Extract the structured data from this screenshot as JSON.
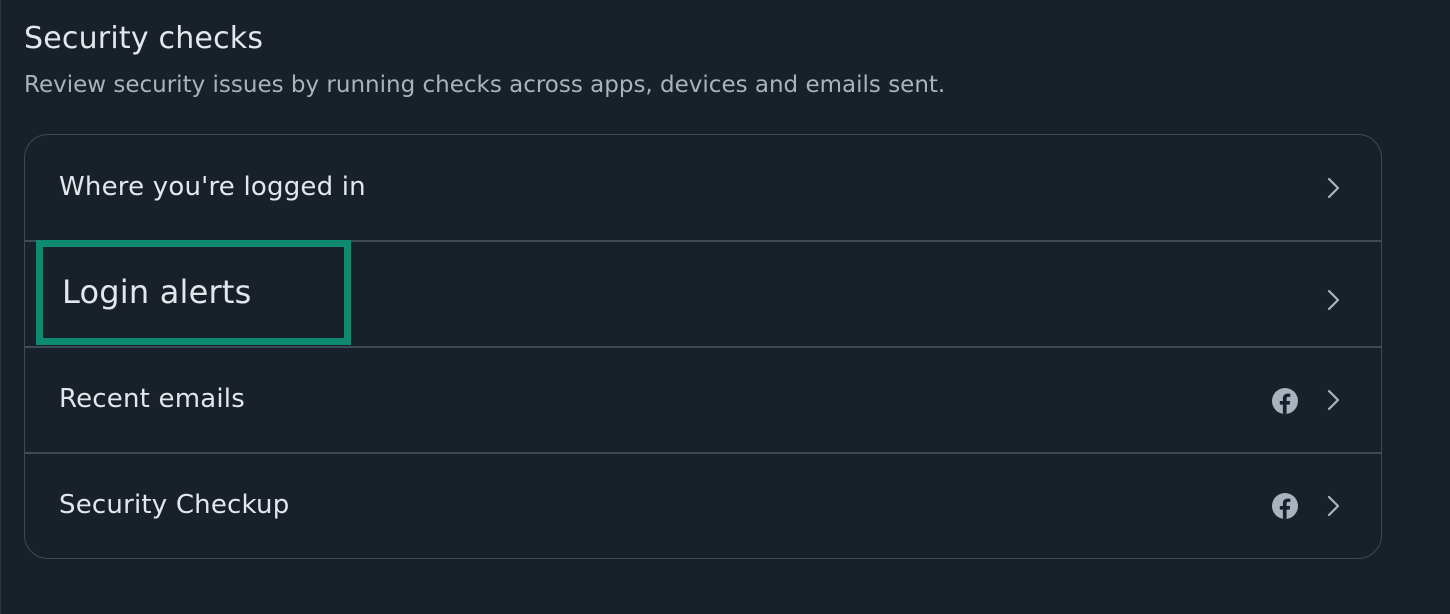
{
  "section": {
    "title": "Security checks",
    "subtitle": "Review security issues by running checks across apps, devices and emails sent."
  },
  "rows": [
    {
      "label": "Where you're logged in",
      "icons": [
        "chevron-right-icon"
      ]
    },
    {
      "label": "Login alerts",
      "icons": [
        "chevron-right-icon"
      ],
      "highlighted": true
    },
    {
      "label": "Recent emails",
      "icons": [
        "facebook-icon",
        "chevron-right-icon"
      ]
    },
    {
      "label": "Security Checkup",
      "icons": [
        "facebook-icon",
        "chevron-right-icon"
      ]
    }
  ],
  "colors": {
    "background": "#18212a",
    "text_primary": "#e4e6eb",
    "text_secondary": "#a8b3bd",
    "border": "#3e4a55",
    "highlight": "#0e8a6e",
    "icon": "#a8b3bd"
  }
}
